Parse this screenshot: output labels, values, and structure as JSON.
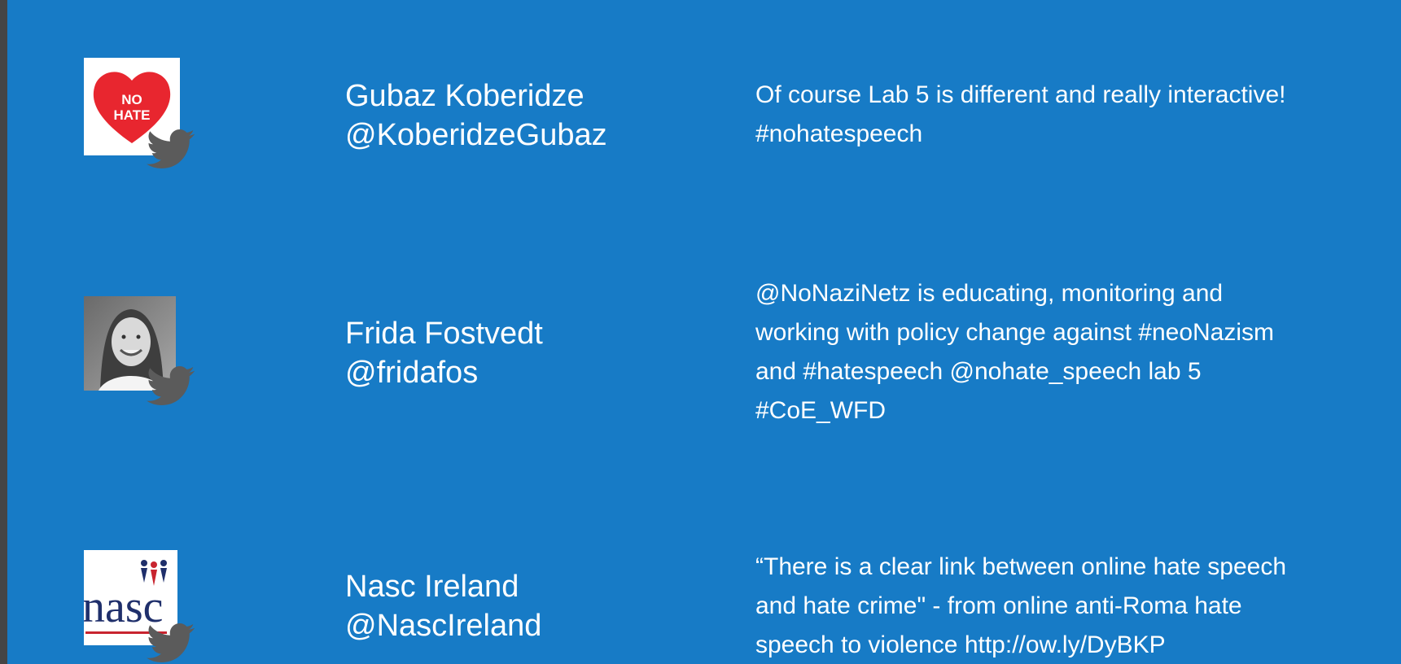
{
  "tweets": [
    {
      "name": "Gubaz Koberidze",
      "handle": "@KoberidzeGubaz",
      "avatar": "no-hate-heart-logo",
      "avatar_text": [
        "NO",
        "HATE"
      ],
      "text_lines": [
        "Of course Lab 5 is different and really interactive!",
        "#nohatespeech"
      ]
    },
    {
      "name": "Frida Fostvedt",
      "handle": "@fridafos",
      "avatar": "profile-photo",
      "text_lines": [
        "@NoNaziNetz is educating, monitoring and",
        "working with policy change against #neoNazism",
        "and #hatespeech @nohate_speech lab 5",
        "#CoE_WFD"
      ]
    },
    {
      "name": "Nasc Ireland",
      "handle": "@NascIreland",
      "avatar": "nasc-logo",
      "avatar_text": [
        "nasc"
      ],
      "text_lines": [
        "“There is a clear link between online hate speech",
        "and hate crime\" - from online anti-Roma hate",
        "speech to violence http://ow.ly/DyBKP"
      ]
    }
  ],
  "icons": {
    "platform": "twitter-bird-icon"
  },
  "colors": {
    "background": "#177bc6",
    "left_strip": "#454545",
    "text": "#ffffff",
    "bird": "#5b5b5b",
    "heart": "#e8262f"
  }
}
